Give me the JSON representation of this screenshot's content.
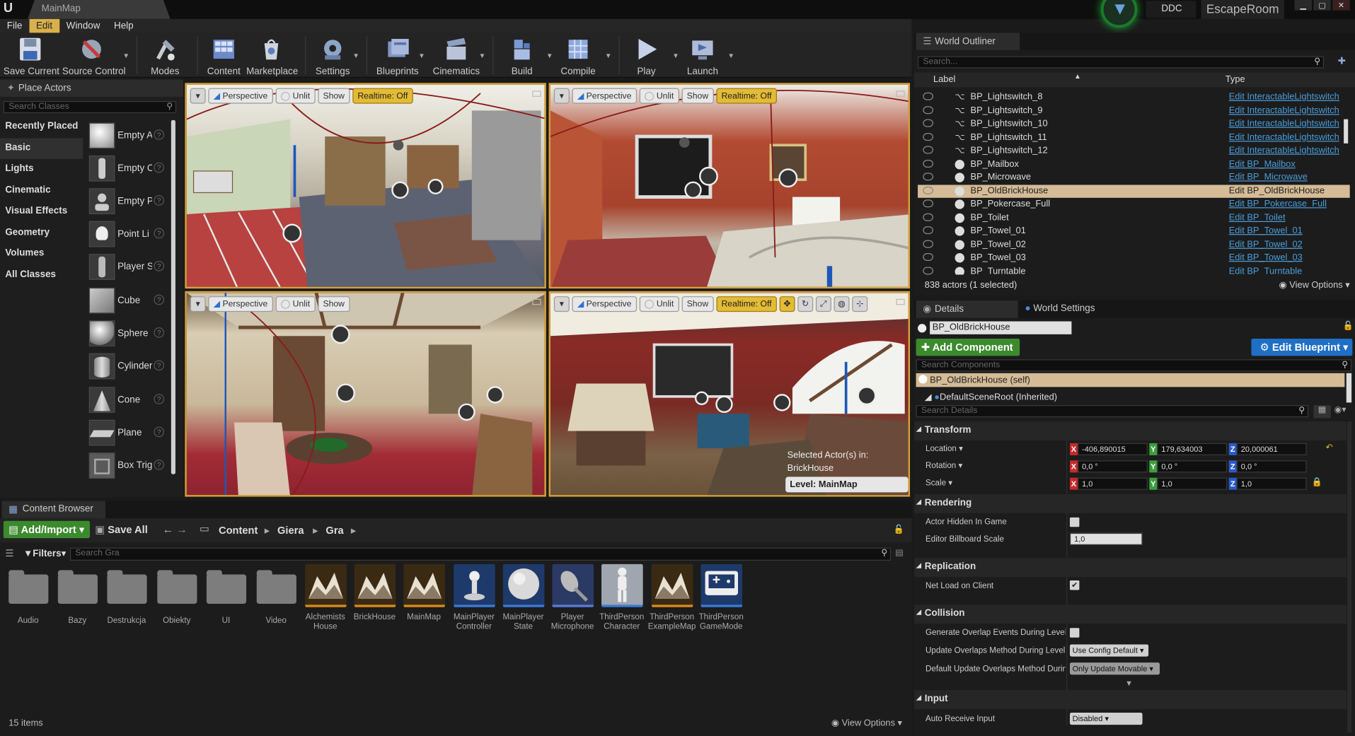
{
  "window": {
    "map_tab": "MainMap",
    "ddc_label": "DDC",
    "project_name": "EscapeRoom"
  },
  "menu": [
    "File",
    "Edit",
    "Window",
    "Help"
  ],
  "toolbar": [
    {
      "label": "Save Current",
      "icon": "save-icon"
    },
    {
      "label": "Source Control",
      "icon": "source-control-icon"
    },
    {
      "label": "Modes",
      "icon": "modes-icon"
    },
    {
      "label": "Content",
      "icon": "content-icon"
    },
    {
      "label": "Marketplace",
      "icon": "marketplace-icon"
    },
    {
      "label": "Settings",
      "icon": "settings-icon"
    },
    {
      "label": "Blueprints",
      "icon": "blueprints-icon"
    },
    {
      "label": "Cinematics",
      "icon": "cinematics-icon"
    },
    {
      "label": "Build",
      "icon": "build-icon"
    },
    {
      "label": "Compile",
      "icon": "compile-icon"
    },
    {
      "label": "Play",
      "icon": "play-icon"
    },
    {
      "label": "Launch",
      "icon": "launch-icon"
    }
  ],
  "place_actors": {
    "tab": "Place Actors",
    "search_placeholder": "Search Classes",
    "categories": [
      "Recently Placed",
      "Basic",
      "Lights",
      "Cinematic",
      "Visual Effects",
      "Geometry",
      "Volumes",
      "All Classes"
    ],
    "items": [
      "Empty A",
      "Empty C",
      "Empty P",
      "Point Li",
      "Player S",
      "Cube",
      "Sphere",
      "Cylinder",
      "Cone",
      "Plane",
      "Box Trig"
    ]
  },
  "viewports": {
    "perspective": "Perspective",
    "unlit": "Unlit",
    "show": "Show",
    "realtime": "Realtime: Off",
    "selected_actor_line1": "Selected Actor(s) in:",
    "selected_actor_line2": "BrickHouse",
    "level_label": "Level:  MainMap (Persistent)"
  },
  "content_browser": {
    "tab": "Content Browser",
    "add_import": "Add/Import",
    "save_all": "Save All",
    "breadcrumb": [
      "Content",
      "Giera",
      "Gra"
    ],
    "filters": "Filters",
    "search_placeholder": "Search Gra",
    "folders": [
      "Audio",
      "Bazy",
      "Destrukcja",
      "Obiekty",
      "UI",
      "Video"
    ],
    "assets": [
      {
        "name": "Alchemists House",
        "kind": "map"
      },
      {
        "name": "BrickHouse",
        "kind": "map"
      },
      {
        "name": "MainMap",
        "kind": "map"
      },
      {
        "name": "MainPlayer Controller",
        "kind": "controller"
      },
      {
        "name": "MainPlayer State",
        "kind": "sphere"
      },
      {
        "name": "Player Microphone",
        "kind": "microphone"
      },
      {
        "name": "ThirdPerson Character",
        "kind": "character"
      },
      {
        "name": "ThirdPerson ExampleMap",
        "kind": "map"
      },
      {
        "name": "ThirdPerson GameMode",
        "kind": "gamemode"
      }
    ],
    "item_count": "15 items",
    "view_options": "View Options"
  },
  "outliner": {
    "tab": "World Outliner",
    "search_placeholder": "Search...",
    "col_label": "Label",
    "col_type": "Type",
    "rows": [
      {
        "label": "BP_Lightswitch_8",
        "type": "Edit InteractableLightswitch",
        "icon": "lightswitch"
      },
      {
        "label": "BP_Lightswitch_9",
        "type": "Edit InteractableLightswitch",
        "icon": "lightswitch"
      },
      {
        "label": "BP_Lightswitch_10",
        "type": "Edit InteractableLightswitch",
        "icon": "lightswitch"
      },
      {
        "label": "BP_Lightswitch_11",
        "type": "Edit InteractableLightswitch",
        "icon": "lightswitch"
      },
      {
        "label": "BP_Lightswitch_12",
        "type": "Edit InteractableLightswitch",
        "icon": "lightswitch"
      },
      {
        "label": "BP_Mailbox",
        "type": "Edit BP_Mailbox",
        "icon": "sphere"
      },
      {
        "label": "BP_Microwave",
        "type": "Edit BP_Microwave",
        "icon": "sphere"
      },
      {
        "label": "BP_OldBrickHouse",
        "type": "Edit BP_OldBrickHouse",
        "icon": "sphere",
        "selected": true
      },
      {
        "label": "BP_Pokercase_Full",
        "type": "Edit BP_Pokercase_Full",
        "icon": "sphere"
      },
      {
        "label": "BP_Toilet",
        "type": "Edit BP_Toilet",
        "icon": "sphere"
      },
      {
        "label": "BP_Towel_01",
        "type": "Edit BP_Towel_01",
        "icon": "sphere"
      },
      {
        "label": "BP_Towel_02",
        "type": "Edit BP_Towel_02",
        "icon": "sphere"
      },
      {
        "label": "BP_Towel_03",
        "type": "Edit BP_Towel_03",
        "icon": "sphere"
      },
      {
        "label": "BP_Turntable",
        "type": "Edit BP_Turntable",
        "icon": "sphere"
      }
    ],
    "actor_count": "838 actors (1 selected)",
    "view_options": "View Options"
  },
  "details": {
    "tab": "Details",
    "world_settings_tab": "World Settings",
    "actor_name": "BP_OldBrickHouse",
    "add_component": "Add Component",
    "edit_blueprint": "Edit Blueprint",
    "search_components": "Search Components",
    "self_component": "BP_OldBrickHouse (self)",
    "root_component": "DefaultSceneRoot (Inherited)",
    "search_details": "Search Details",
    "sections": {
      "transform": "Transform",
      "rendering": "Rendering",
      "replication": "Replication",
      "collision": "Collision",
      "input": "Input"
    },
    "location_label": "Location",
    "rotation_label": "Rotation",
    "scale_label": "Scale",
    "location": [
      "-406,890015",
      "179,634003",
      "20,000061"
    ],
    "rotation": [
      "0,0 °",
      "0,0 °",
      "0,0 °"
    ],
    "scale": [
      "1,0",
      "1,0",
      "1,0"
    ],
    "actor_hidden": "Actor Hidden In Game",
    "billboard_scale_label": "Editor Billboard Scale",
    "billboard_scale": "1,0",
    "net_load": "Net Load on Client",
    "gen_overlap": "Generate Overlap Events During Level S",
    "update_overlaps": "Update Overlaps Method During Level S",
    "update_overlaps_value": "Use Config Default",
    "default_update": "Default Update Overlaps Method During",
    "default_update_value": "Only Update Movable",
    "auto_receive": "Auto Receive Input",
    "auto_receive_value": "Disabled"
  },
  "colors": {
    "accent_gold": "#d8a23a",
    "green_button": "#3c8a2e",
    "blue_button": "#1f6fc4",
    "link_blue": "#4a9ddb",
    "selection": "#d5bc97"
  }
}
